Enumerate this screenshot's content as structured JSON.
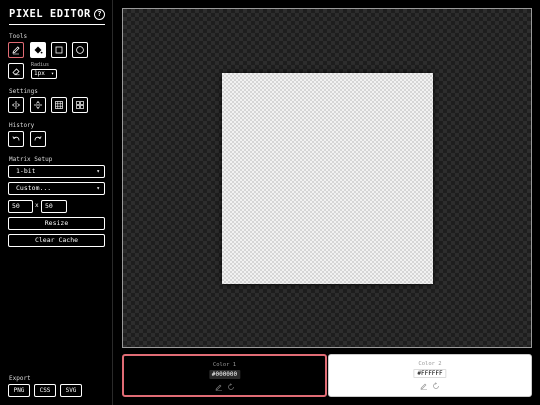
{
  "app": {
    "title": "PIXEL EDITOR",
    "help_glyph": "?"
  },
  "tools": {
    "label": "Tools",
    "items": [
      {
        "name": "pencil",
        "icon": "pencil-icon",
        "selected": true
      },
      {
        "name": "fill",
        "icon": "fill-bucket-icon",
        "selected": false
      },
      {
        "name": "rectangle",
        "icon": "rectangle-icon",
        "selected": false
      },
      {
        "name": "circle",
        "icon": "circle-icon",
        "selected": false
      },
      {
        "name": "eraser",
        "icon": "eraser-icon",
        "selected": false
      }
    ],
    "radius_label": "Radius",
    "radius_value": "1px"
  },
  "settings": {
    "label": "Settings",
    "items": [
      "mirror-vertical-icon",
      "mirror-horizontal-icon",
      "grid-icon",
      "tile-icon"
    ]
  },
  "history": {
    "label": "History",
    "items": [
      "undo-icon",
      "redo-icon"
    ]
  },
  "matrix": {
    "label": "Matrix Setup",
    "bit_depth": "1-bit",
    "preset": "Custom...",
    "width": "50",
    "times": "x",
    "height": "50",
    "resize_label": "Resize",
    "clear_label": "Clear Cache"
  },
  "export": {
    "label": "Export",
    "formats": [
      "PNG",
      "CSS",
      "SVG"
    ]
  },
  "colors": {
    "accent": "#e06c75",
    "color1": {
      "label": "Color 1",
      "hex": "#000000"
    },
    "color2": {
      "label": "Color 2",
      "hex": "#FFFFFF"
    }
  }
}
